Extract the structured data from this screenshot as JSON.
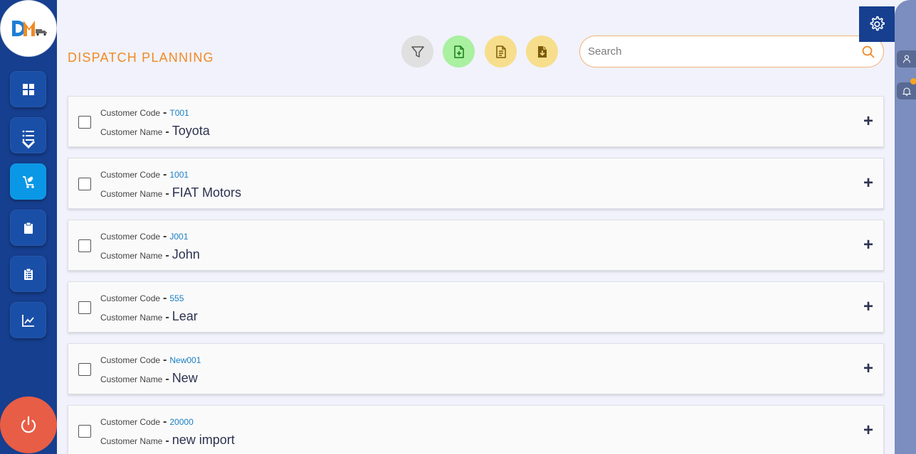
{
  "header": {
    "title": "DISPATCH PLANNING"
  },
  "logo": {
    "text_d": "D",
    "text_m": "M"
  },
  "search": {
    "placeholder": "Search",
    "value": ""
  },
  "sidebar": {
    "items": [
      {
        "icon": "dashboard-icon",
        "active": false
      },
      {
        "icon": "list-icon",
        "active": false
      },
      {
        "icon": "dispatch-trolley-icon",
        "active": true
      },
      {
        "icon": "clipboard-icon",
        "active": false
      },
      {
        "icon": "clipboard-list-icon",
        "active": false
      },
      {
        "icon": "chart-icon",
        "active": false
      }
    ],
    "power": "power-icon"
  },
  "toolbar": {
    "filter": "filter-icon",
    "add_file": "file-add-icon",
    "document": "document-icon",
    "download": "file-download-icon",
    "settings": "gear-icon"
  },
  "colors": {
    "sidebar": "#163f8f",
    "active": "#0a97e6",
    "title": "#f08a24",
    "power": "#e85d45",
    "code": "#1a7fc4"
  },
  "list": {
    "code_label": "Customer Code",
    "name_label": "Customer Name",
    "dash": "-",
    "expand": "+",
    "rows": [
      {
        "code": "T001",
        "name": "Toyota"
      },
      {
        "code": "1001",
        "name": "FIAT Motors"
      },
      {
        "code": "J001",
        "name": "John"
      },
      {
        "code": "555",
        "name": "Lear"
      },
      {
        "code": "New001",
        "name": "New"
      },
      {
        "code": "20000",
        "name": "new import"
      }
    ]
  }
}
